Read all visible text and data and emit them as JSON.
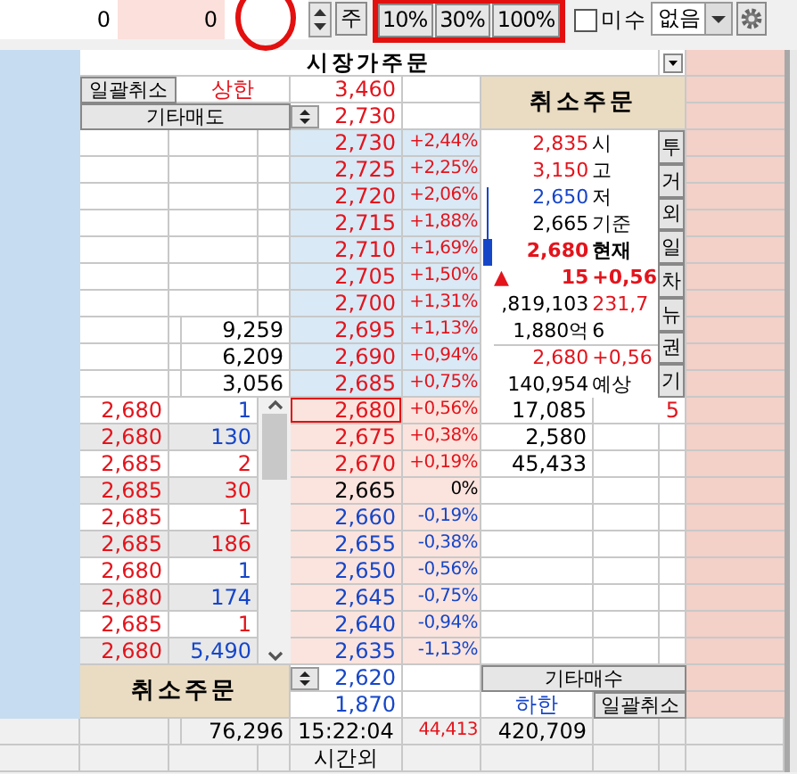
{
  "toolbar": {
    "fields": [
      "0",
      "0"
    ],
    "unit_button": "주",
    "percent_buttons": [
      "10%",
      "30%",
      "100%"
    ],
    "margin_checkbox": {
      "label": "미수",
      "checked": false
    },
    "credit_select": {
      "value": "없음"
    }
  },
  "order_book": {
    "title": "시장가주문",
    "sell_header": {
      "cancel_all": "일괄취소",
      "upper_label": "상한",
      "upper_price": "3,460",
      "other_sell": "기타매도",
      "other_sell_price": "2,730"
    },
    "cancel_orders": "취소주문",
    "asks": [
      {
        "price": "2,730",
        "change": "+2,44%",
        "color": "#e3141c"
      },
      {
        "price": "2,725",
        "change": "+2,25%",
        "color": "#e3141c"
      },
      {
        "price": "2,720",
        "change": "+2,06%",
        "color": "#e3141c"
      },
      {
        "price": "2,715",
        "change": "+1,88%",
        "color": "#e3141c"
      },
      {
        "price": "2,710",
        "change": "+1,69%",
        "color": "#e3141c"
      },
      {
        "price": "2,705",
        "change": "+1,50%",
        "color": "#e3141c"
      },
      {
        "price": "2,700",
        "change": "+1,31%",
        "color": "#e3141c"
      },
      {
        "quantity": "9,259",
        "price": "2,695",
        "change": "+1,13%",
        "color": "#e3141c"
      },
      {
        "quantity": "6,209",
        "price": "2,690",
        "change": "+0,94%",
        "color": "#e3141c"
      },
      {
        "quantity": "3,056",
        "price": "2,685",
        "change": "+0,75%",
        "color": "#e3141c"
      }
    ],
    "info": [
      {
        "figure": "2,835",
        "color": "#e3141c",
        "term": {
          "text": "시",
          "color": "#000000"
        },
        "bold": false
      },
      {
        "figure": "3,150",
        "color": "#e3141c",
        "term": {
          "text": "고",
          "color": "#000000"
        },
        "bold": false
      },
      {
        "figure": "2,650",
        "color": "#1646c8",
        "term": {
          "text": "저",
          "color": "#000000"
        },
        "bold": false
      },
      {
        "figure": "2,665",
        "color": "#000000",
        "term": {
          "text": "기준",
          "color": "#000000"
        },
        "bold": false
      },
      {
        "figure": "2,680",
        "color": "#e3141c",
        "term": {
          "text": "현재",
          "color": "#000000"
        },
        "bold": true
      },
      {
        "arrow": "▲",
        "figure": "15",
        "color": "#e3141c",
        "term": {
          "text": "+0,56",
          "color": "#e3141c"
        },
        "bold": true
      },
      {
        "figure": ",819,103",
        "color": "#000000",
        "term": {
          "text": "231,7",
          "color": "#e3141c"
        },
        "bold": false
      },
      {
        "figure": "1,880억",
        "color": "#000000",
        "term": {
          "text": "6",
          "color": "#000000"
        },
        "bold": false
      },
      {
        "figure": "2,680",
        "color": "#e3141c",
        "term": {
          "text": "+0,56",
          "color": "#e3141c"
        },
        "bold": false
      },
      {
        "figure": "140,954",
        "color": "#000000",
        "term": {
          "text": "예상",
          "color": "#000000"
        },
        "bold": false
      }
    ],
    "info_tabs": [
      "투",
      "거",
      "외",
      "일",
      "차",
      "뉴",
      "권",
      "기"
    ],
    "bids": [
      {
        "order_price": "2,680",
        "order_quantity": {
          "text": "1",
          "color": "#1646c8"
        },
        "price": "2,680",
        "change": "+0,56%",
        "color": "#e3141c",
        "current": true,
        "volume": "17,085",
        "count": "5"
      },
      {
        "order_price": "2,680",
        "order_quantity": {
          "text": "130",
          "color": "#1646c8"
        },
        "price": "2,675",
        "change": "+0,38%",
        "color": "#e3141c",
        "current": false,
        "volume": "2,580"
      },
      {
        "order_price": "2,685",
        "order_quantity": {
          "text": "2",
          "color": "#e3141c"
        },
        "price": "2,670",
        "change": "+0,19%",
        "color": "#e3141c",
        "current": false,
        "volume": "45,433"
      },
      {
        "order_price": "2,685",
        "order_quantity": {
          "text": "30",
          "color": "#e3141c"
        },
        "price": "2,665",
        "change": "0%",
        "color": "#000000",
        "current": false
      },
      {
        "order_price": "2,685",
        "order_quantity": {
          "text": "1",
          "color": "#e3141c"
        },
        "price": "2,660",
        "change": "-0,19%",
        "color": "#1646c8",
        "current": false
      },
      {
        "order_price": "2,685",
        "order_quantity": {
          "text": "186",
          "color": "#e3141c"
        },
        "price": "2,655",
        "change": "-0,38%",
        "color": "#1646c8",
        "current": false
      },
      {
        "order_price": "2,680",
        "order_quantity": {
          "text": "1",
          "color": "#1646c8"
        },
        "price": "2,650",
        "change": "-0,56%",
        "color": "#1646c8",
        "current": false
      },
      {
        "order_price": "2,680",
        "order_quantity": {
          "text": "174",
          "color": "#1646c8"
        },
        "price": "2,645",
        "change": "-0,75%",
        "color": "#1646c8",
        "current": false
      },
      {
        "order_price": "2,685",
        "order_quantity": {
          "text": "1",
          "color": "#e3141c"
        },
        "price": "2,640",
        "change": "-0,94%",
        "color": "#1646c8",
        "current": false
      },
      {
        "order_price": "2,680",
        "order_quantity": {
          "text": "5,490",
          "color": "#1646c8"
        },
        "price": "2,635",
        "change": "-1,13%",
        "color": "#1646c8",
        "current": false
      }
    ],
    "footer": {
      "cancel_orders": "취소주문",
      "other_buy_price": "2,620",
      "lower_price": "1,870",
      "other_buy": "기타매수",
      "lower_label": "하한",
      "cancel_all": "일괄취소"
    },
    "totals": {
      "ask_total": "76,296",
      "time": "15:22:04",
      "column_7": "44,413",
      "bid_total": "420,709",
      "session": "시간외"
    }
  }
}
